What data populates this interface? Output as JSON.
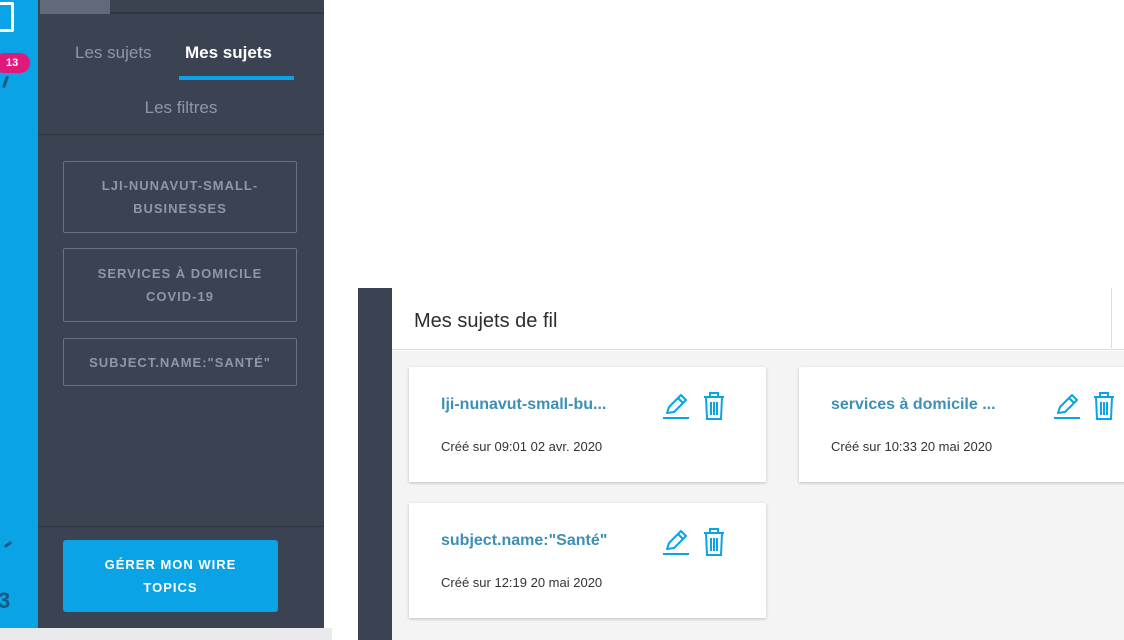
{
  "rail": {
    "badge_count": "13",
    "accent_color": "#0aa3e6",
    "badge_color": "#e0197d"
  },
  "panel": {
    "tabs": [
      {
        "label": "Les sujets",
        "active": false
      },
      {
        "label": "Mes sujets",
        "active": true
      }
    ],
    "filters_label": "Les filtres",
    "topics": [
      {
        "label": "LJI-NUNAVUT-SMALL-BUSINESSES"
      },
      {
        "label": "SERVICES À DOMICILE COVID-19"
      },
      {
        "label": "SUBJECT.NAME:\"SANTÉ\""
      }
    ],
    "manage_button_label": "GÉRER MON WIRE TOPICS",
    "background_color": "#3b4252"
  },
  "content": {
    "title": "Mes sujets de fil",
    "cards": [
      {
        "title": "lji-nunavut-small-bu...",
        "date": "Créé sur 09:01 02 avr. 2020",
        "icons": [
          "pencil-icon",
          "trash-icon"
        ]
      },
      {
        "title": "services à domicile ...",
        "date": "Créé sur 10:33 20 mai 2020",
        "icons": [
          "pencil-icon",
          "trash-icon"
        ]
      },
      {
        "title": "subject.name:\"Santé\"",
        "date": "Créé sur 12:19 20 mai 2020",
        "icons": [
          "pencil-icon",
          "trash-icon"
        ]
      }
    ],
    "link_color": "#3d8fb4",
    "icon_color": "#0aa3e6"
  }
}
